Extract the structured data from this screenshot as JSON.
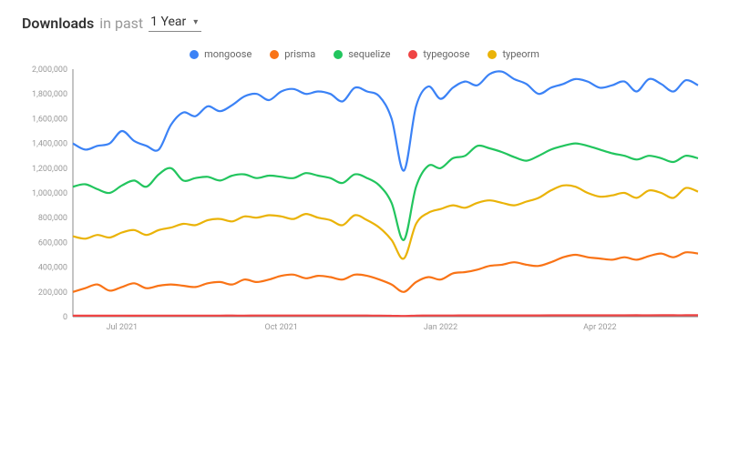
{
  "header": {
    "title": "Downloads",
    "sub": "in past",
    "range": "1 Year"
  },
  "chart_data": {
    "type": "line",
    "title": "",
    "xlabel": "",
    "ylabel": "",
    "ylim": [
      0,
      2000000
    ],
    "yticks": [
      0,
      200000,
      400000,
      600000,
      800000,
      1000000,
      1200000,
      1400000,
      1600000,
      1800000,
      2000000
    ],
    "ytick_labels": [
      "0",
      "200,000",
      "400,000",
      "600,000",
      "800,000",
      "1,000,000",
      "1,200,000",
      "1,400,000",
      "1,600,000",
      "1,800,000",
      "2,000,000"
    ],
    "x_domain": [
      0,
      51
    ],
    "xticks": [
      4,
      17,
      30,
      43
    ],
    "xtick_labels": [
      "Jul 2021",
      "Oct 2021",
      "Jan 2022",
      "Apr 2022"
    ],
    "series": [
      {
        "name": "mongoose",
        "color": "#3b82f6",
        "values": [
          1400000,
          1350000,
          1380000,
          1400000,
          1500000,
          1420000,
          1380000,
          1350000,
          1550000,
          1650000,
          1620000,
          1700000,
          1660000,
          1710000,
          1780000,
          1800000,
          1750000,
          1820000,
          1840000,
          1800000,
          1820000,
          1800000,
          1740000,
          1850000,
          1820000,
          1780000,
          1600000,
          1180000,
          1700000,
          1860000,
          1760000,
          1850000,
          1900000,
          1870000,
          1960000,
          1980000,
          1920000,
          1880000,
          1800000,
          1850000,
          1880000,
          1920000,
          1900000,
          1850000,
          1870000,
          1900000,
          1820000,
          1920000,
          1880000,
          1820000,
          1910000,
          1870000
        ]
      },
      {
        "name": "prisma",
        "color": "#f97316",
        "values": [
          200000,
          230000,
          260000,
          210000,
          240000,
          270000,
          230000,
          250000,
          260000,
          250000,
          240000,
          270000,
          280000,
          260000,
          300000,
          280000,
          300000,
          330000,
          340000,
          310000,
          330000,
          320000,
          300000,
          340000,
          330000,
          300000,
          260000,
          200000,
          280000,
          320000,
          300000,
          350000,
          360000,
          380000,
          410000,
          420000,
          440000,
          420000,
          410000,
          440000,
          480000,
          500000,
          480000,
          470000,
          460000,
          480000,
          460000,
          490000,
          510000,
          480000,
          520000,
          510000
        ]
      },
      {
        "name": "sequelize",
        "color": "#22c55e",
        "values": [
          1050000,
          1070000,
          1030000,
          1000000,
          1060000,
          1100000,
          1050000,
          1150000,
          1200000,
          1100000,
          1120000,
          1130000,
          1100000,
          1140000,
          1150000,
          1120000,
          1140000,
          1130000,
          1120000,
          1160000,
          1140000,
          1120000,
          1080000,
          1150000,
          1120000,
          1060000,
          920000,
          620000,
          1050000,
          1220000,
          1200000,
          1280000,
          1300000,
          1380000,
          1360000,
          1330000,
          1290000,
          1260000,
          1300000,
          1350000,
          1380000,
          1400000,
          1380000,
          1350000,
          1320000,
          1300000,
          1270000,
          1300000,
          1280000,
          1250000,
          1300000,
          1280000
        ]
      },
      {
        "name": "typegoose",
        "color": "#ef4444",
        "values": [
          8000,
          8200,
          8100,
          8300,
          8500,
          8400,
          8600,
          8700,
          8500,
          8800,
          9000,
          8900,
          9100,
          9200,
          9000,
          9300,
          9400,
          9200,
          9500,
          9600,
          9400,
          9700,
          9800,
          9600,
          9200,
          8800,
          7500,
          6000,
          8500,
          9400,
          9600,
          9800,
          10000,
          10200,
          10100,
          10300,
          10500,
          10400,
          10600,
          10800,
          11000,
          10900,
          11100,
          11200,
          11000,
          11300,
          11400,
          11200,
          11500,
          11600,
          11400,
          11700
        ]
      },
      {
        "name": "typeorm",
        "color": "#eab308",
        "values": [
          650000,
          630000,
          660000,
          640000,
          680000,
          700000,
          660000,
          700000,
          720000,
          750000,
          740000,
          780000,
          790000,
          770000,
          810000,
          800000,
          820000,
          810000,
          790000,
          830000,
          800000,
          780000,
          740000,
          820000,
          780000,
          720000,
          620000,
          470000,
          750000,
          840000,
          870000,
          900000,
          880000,
          920000,
          940000,
          920000,
          900000,
          930000,
          960000,
          1020000,
          1060000,
          1050000,
          1000000,
          970000,
          980000,
          1000000,
          960000,
          1020000,
          1000000,
          960000,
          1040000,
          1010000
        ]
      }
    ]
  }
}
